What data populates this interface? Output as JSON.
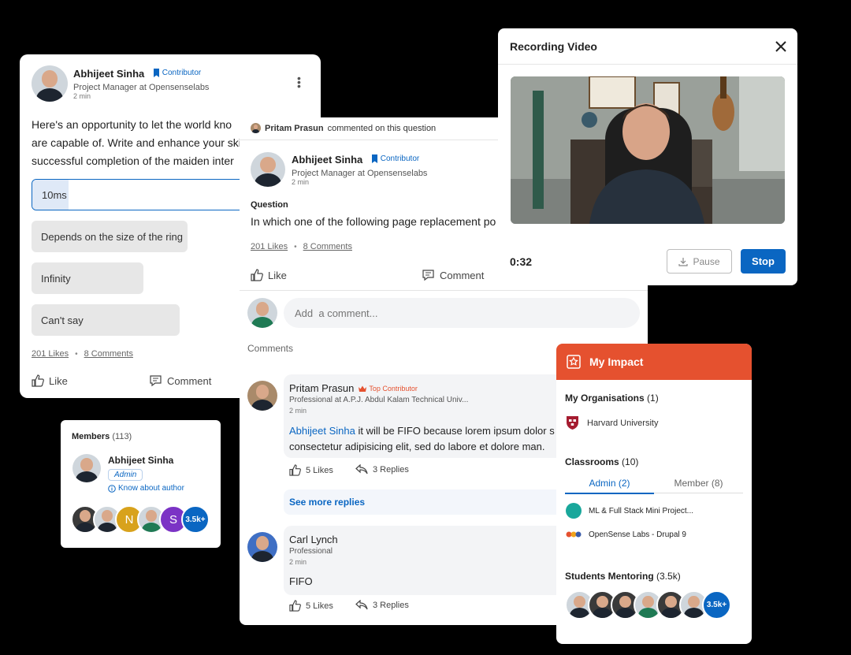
{
  "poll_card": {
    "author_name": "Abhijeet Sinha",
    "author_badge": "Contributor",
    "author_title": "Project Manager at Opensenselabs",
    "author_time": "2 min",
    "text_line1": "Here's an opportunity to let the world kno",
    "text_line2": "are capable of. Write and enhance your ski",
    "text_line3": "successful completion of the maiden inter",
    "options": [
      "10ms",
      "Depends on the size of the ring",
      "Infinity",
      "Can't say"
    ],
    "likes": "201 Likes",
    "comments": "8 Comments",
    "like_label": "Like",
    "comment_label": "Comment"
  },
  "question_card": {
    "commenter_line_name": "Pritam Prasun",
    "commenter_line_text": "commented on this question",
    "author_name": "Abhijeet Sinha",
    "author_badge": "Contributor",
    "author_title": "Project Manager at Opensenselabs",
    "author_time": "2 min",
    "section_label": "Question",
    "question_text": "In which one of the following page replacement po",
    "likes": "201 Likes",
    "comments": "8 Comments",
    "like_label": "Like",
    "comment_label": "Comment",
    "comment_placeholder": "Add  a comment...",
    "comments_heading": "Comments",
    "comment1": {
      "name": "Pritam Prasun",
      "badge": "Top Contributor",
      "title": "Professional at A.P.J. Abdul Kalam Technical Univ...",
      "time": "2 min",
      "mention": "Abhijeet Sinha",
      "text_line1": " it will be FIFO because lorem ipsum dolor s",
      "text_line2": "consectetur adipisicing elit, sed do labore et dolore man.",
      "likes": "5 Likes",
      "replies": "3 Replies"
    },
    "see_more": "See more replies",
    "comment2": {
      "name": "Carl Lynch",
      "title": "Professional",
      "time": "2 min",
      "text": "FIFO",
      "likes": "5 Likes",
      "replies": "3 Replies"
    }
  },
  "recording": {
    "title": "Recording Video",
    "timer": "0:32",
    "pause_label": "Pause",
    "stop_label": "Stop"
  },
  "impact": {
    "title": "My Impact",
    "orgs_label": "My Organisations",
    "orgs_count": "(1)",
    "org_name": "Harvard University",
    "classrooms_label": "Classrooms",
    "classrooms_count": "(10)",
    "tab_admin": "Admin (2)",
    "tab_member": "Member (8)",
    "class1": "ML & Full Stack Mini Project...",
    "class2": "OpenSense Labs - Drupal 9",
    "mentoring_label": "Students Mentoring",
    "mentoring_count": "(3.5k)",
    "mentoring_more": "3.5k+"
  },
  "members": {
    "label": "Members",
    "count": "(113)",
    "author_name": "Abhijeet Sinha",
    "author_role": "Admin",
    "know_label": "Know about author",
    "initial_n": "N",
    "initial_s": "S",
    "more": "3.5k+"
  },
  "colors": {
    "accent": "#0a66c2",
    "impact_orange": "#e5512f",
    "stop_blue": "#0a66c2"
  }
}
